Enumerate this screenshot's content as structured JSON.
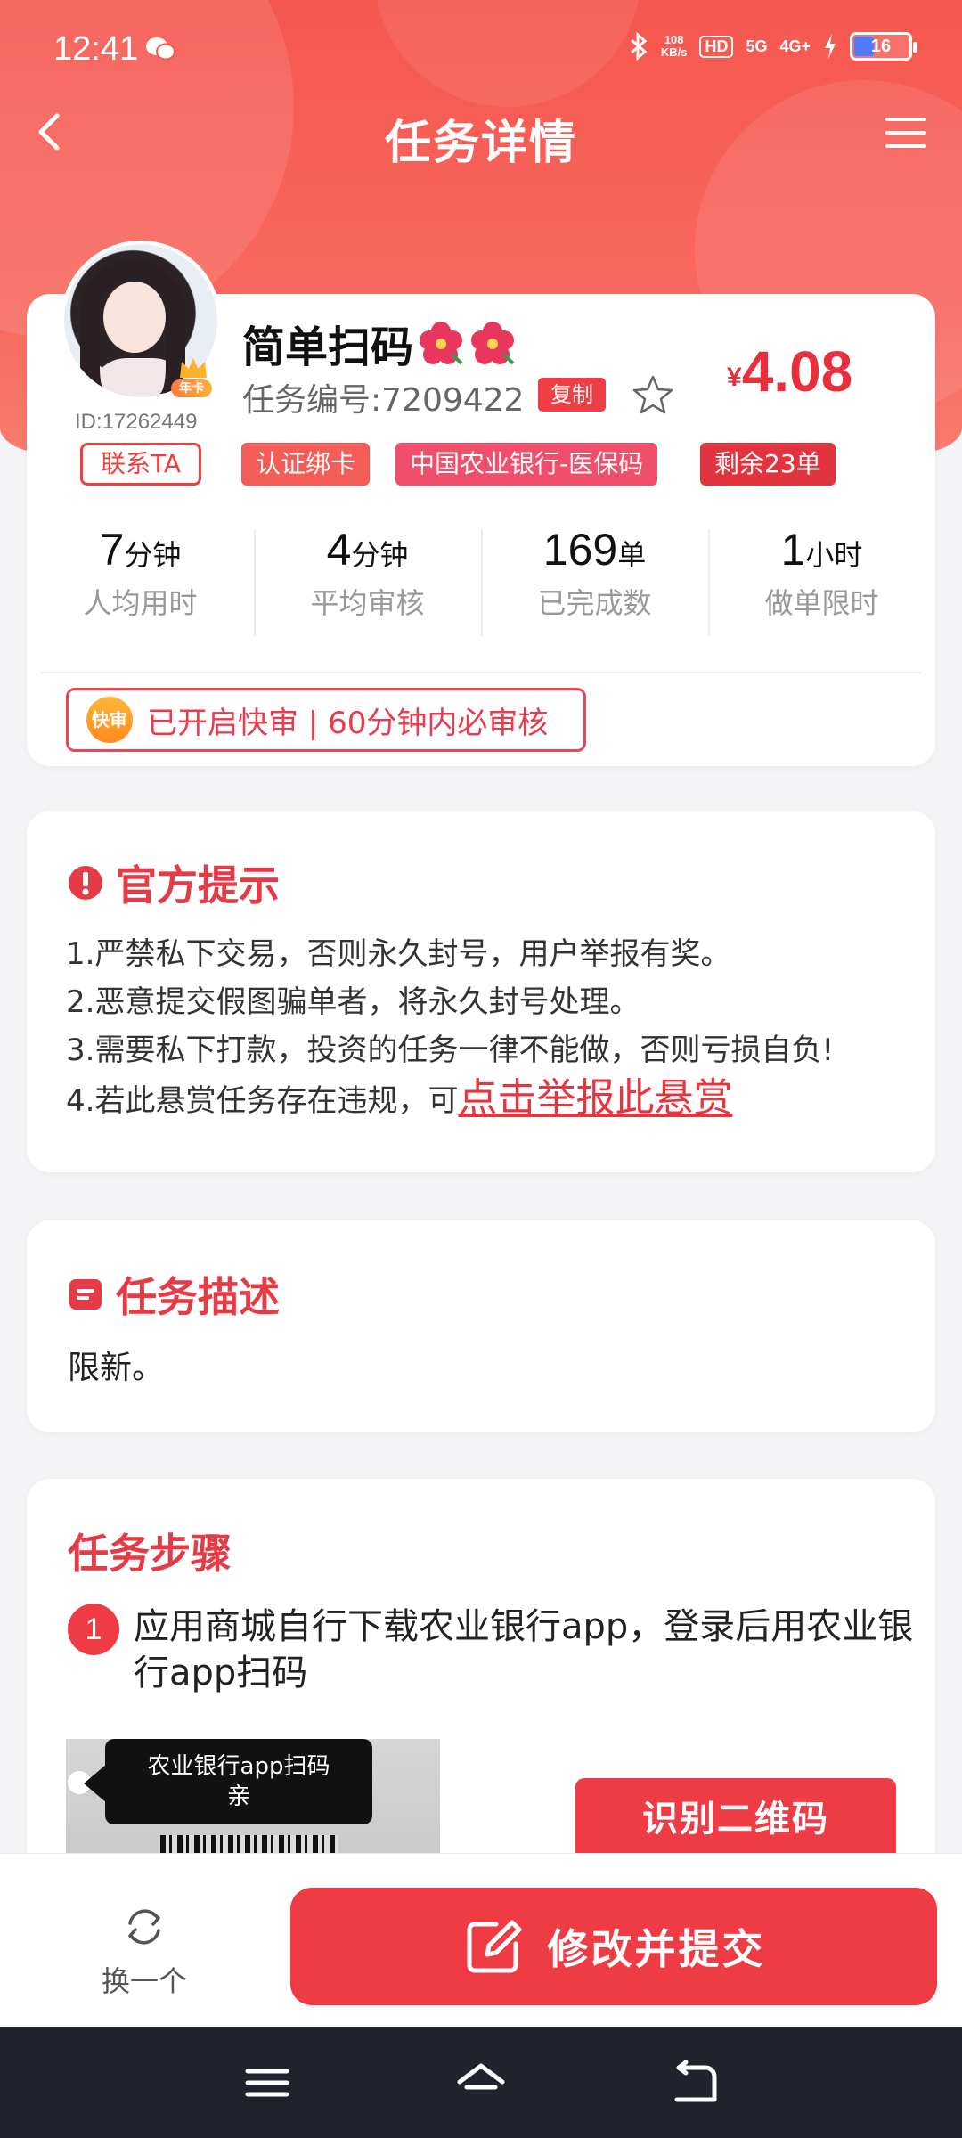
{
  "status_bar": {
    "time": "12:41",
    "speed_value": "108",
    "speed_unit": "KB/s",
    "hd": "HD",
    "net1": "5G",
    "net2": "4G+",
    "battery": "16"
  },
  "nav": {
    "title": "任务详情",
    "back_icon": "back-arrow-icon",
    "menu_icon": "menu-icon"
  },
  "task": {
    "name": "简单扫码",
    "task_id_label": "任务编号:7209422",
    "copy_label": "复制",
    "user_id": "ID:17262449",
    "member_badge": "年卡",
    "contact_label": "联系TA",
    "price_currency": "¥",
    "price_value": "4.08",
    "tags": [
      "认证绑卡",
      "中国农业银行-医保码",
      "剩余23单"
    ],
    "stats": [
      {
        "value": "7",
        "unit": "分钟",
        "label": "人均用时"
      },
      {
        "value": "4",
        "unit": "分钟",
        "label": "平均审核"
      },
      {
        "value": "169",
        "unit": "单",
        "label": "已完成数"
      },
      {
        "value": "1",
        "unit": "小时",
        "label": "做单限时"
      }
    ],
    "fast_badge": "快审",
    "fast_text": "已开启快审 | 60分钟内必审核"
  },
  "notice": {
    "title": "官方提示",
    "items": [
      "1.严禁私下交易，否则永久封号，用户举报有奖。",
      "2.恶意提交假图骗单者，将永久封号处理。",
      "3.需要私下打款，投资的任务一律不能做，否则亏损自负!",
      "4.若此悬赏任务存在违规，可"
    ],
    "report_link": "点击举报此悬赏"
  },
  "description": {
    "title": "任务描述",
    "text": "限新。"
  },
  "steps": {
    "title": "任务步骤",
    "step1_number": "1",
    "step1_text": "应用商城自行下载农业银行app，登录后用农业银行app扫码",
    "image_tip_line1": "农业银行app扫码",
    "image_tip_line2": "亲",
    "qr_button": "识别二维码"
  },
  "action_bar": {
    "swap_label": "换一个",
    "submit_label": "修改并提交"
  },
  "colors": {
    "accent": "#ef3b43",
    "header": "#f5574f"
  }
}
